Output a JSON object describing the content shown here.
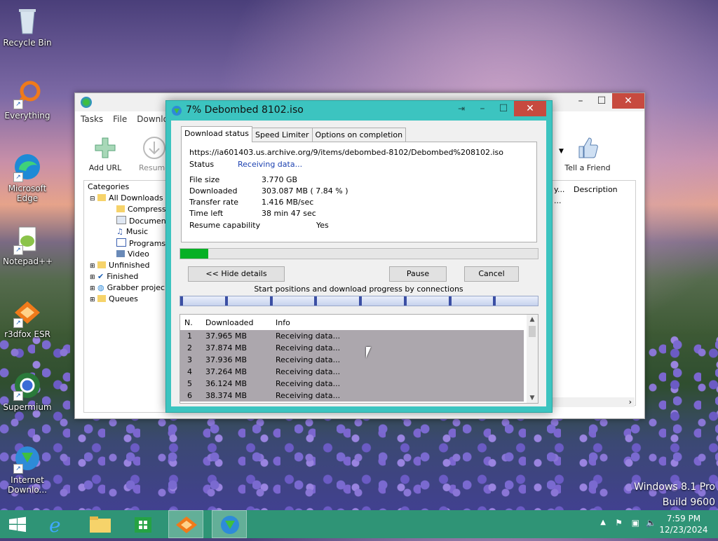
{
  "desktop": {
    "icons": [
      {
        "label": "Recycle Bin",
        "icon": "recycle-bin-icon"
      },
      {
        "label": "Everything",
        "icon": "search-icon"
      },
      {
        "label": "Microsoft Edge",
        "icon": "edge-icon"
      },
      {
        "label": "Notepad++",
        "icon": "notepad-icon"
      },
      {
        "label": "r3dfox ESR",
        "icon": "fox-icon"
      },
      {
        "label": "Supermium",
        "icon": "browser-icon"
      },
      {
        "label": "Internet Downlo...",
        "icon": "idm-icon"
      }
    ],
    "watermark": [
      "Windows 8.1 Pro",
      "Build 9600"
    ]
  },
  "main_window": {
    "menu": [
      "Tasks",
      "File",
      "Downlo"
    ],
    "toolbar": [
      {
        "label": "Add URL",
        "icon": "plus-icon"
      },
      {
        "label": "Resume",
        "icon": "download-arrow-icon"
      },
      {
        "label": "Tell a Friend",
        "icon": "thumbs-up-icon"
      }
    ],
    "categories": {
      "header": "Categories",
      "items": [
        "All Downloads",
        "Compresse",
        "Documents",
        "Music",
        "Programs",
        "Video",
        "Unfinished",
        "Finished",
        "Grabber projec",
        "Queues"
      ]
    },
    "list_columns": [
      "y...",
      "Description"
    ],
    "list_cell": "..."
  },
  "dialog": {
    "title": "7% Debombed 8102.iso",
    "tabs": [
      "Download status",
      "Speed Limiter",
      "Options on completion"
    ],
    "url": "https://ia601403.us.archive.org/9/items/debombed-8102/Debombed%208102.iso",
    "status_label": "Status",
    "status_value": "Receiving data...",
    "file_size_label": "File size",
    "file_size_value": "3.770  GB",
    "downloaded_label": "Downloaded",
    "downloaded_value": "303.087  MB  ( 7.84 % )",
    "transfer_rate_label": "Transfer rate",
    "transfer_rate_value": "1.416  MB/sec",
    "time_left_label": "Time left",
    "time_left_value": "38 min 47 sec",
    "resume_label": "Resume capability",
    "resume_value": "Yes",
    "progress_fraction": 0.0784,
    "buttons": {
      "hide": "<< Hide details",
      "pause": "Pause",
      "cancel": "Cancel"
    },
    "connections_label": "Start positions and download progress by connections",
    "connection_marks": 8,
    "table": {
      "columns": [
        "N.",
        "Downloaded",
        "Info"
      ],
      "rows": [
        [
          "1",
          "37.965  MB",
          "Receiving data..."
        ],
        [
          "2",
          "37.874  MB",
          "Receiving data..."
        ],
        [
          "3",
          "37.936  MB",
          "Receiving data..."
        ],
        [
          "4",
          "37.264  MB",
          "Receiving data..."
        ],
        [
          "5",
          "36.124  MB",
          "Receiving data..."
        ],
        [
          "6",
          "38.374  MB",
          "Receiving data..."
        ]
      ]
    }
  },
  "taskbar": {
    "items": [
      "start-icon",
      "internet-explorer-icon",
      "file-explorer-icon",
      "store-icon",
      "r3dfox-icon",
      "idm-icon"
    ],
    "time": "7:59 PM",
    "date": "12/23/2024"
  },
  "colors": {
    "dialog_accent": "#3cc4c0",
    "progress": "#06b025",
    "close": "#c74a3f",
    "taskbar": "#28a06e"
  }
}
